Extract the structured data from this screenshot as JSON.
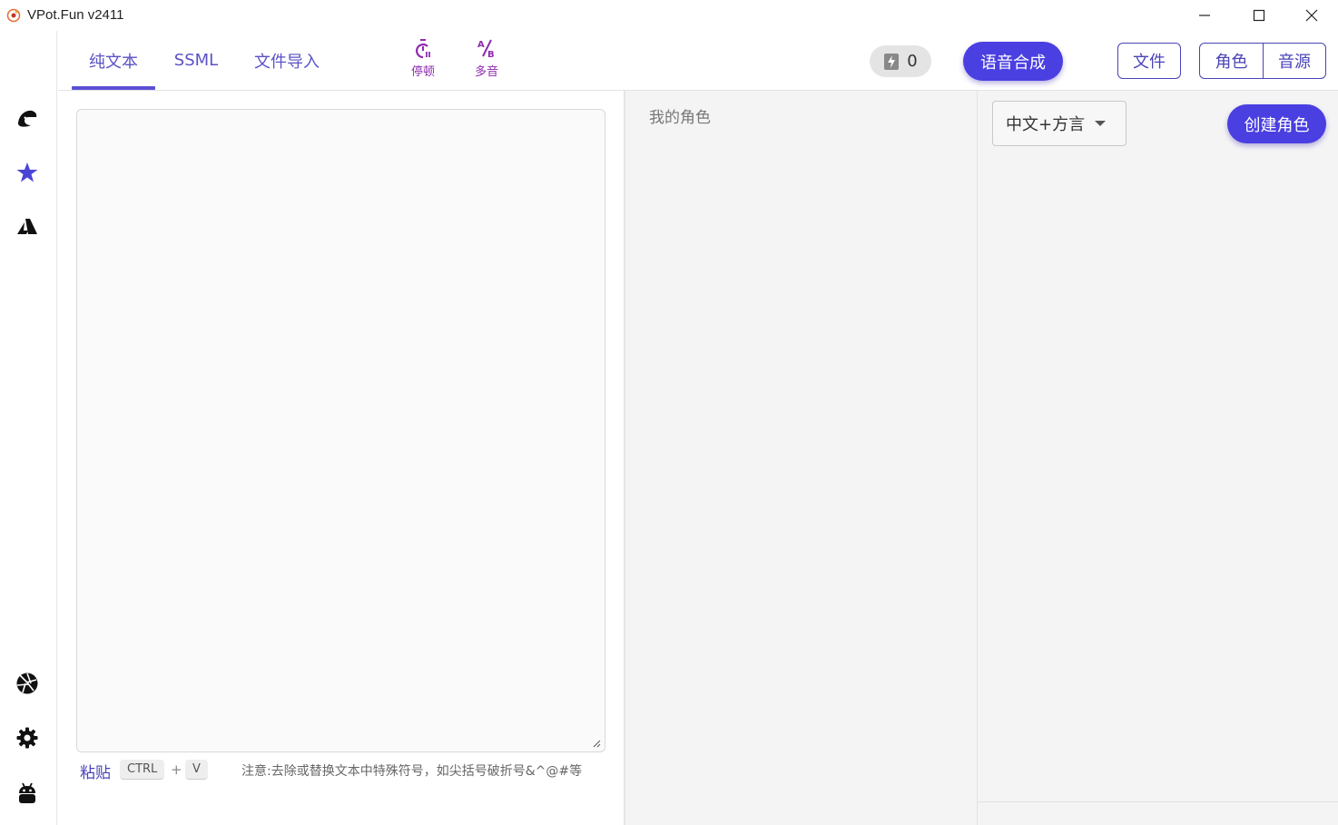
{
  "window": {
    "title": "VPot.Fun v2411"
  },
  "sidebar": {
    "icons": [
      "edge-icon",
      "star-icon",
      "azure-icon",
      "aperture-icon",
      "settings-icon",
      "android-icon"
    ]
  },
  "toolbar": {
    "tabs": [
      {
        "label": "纯文本",
        "active": true
      },
      {
        "label": "SSML",
        "active": false
      },
      {
        "label": "文件导入",
        "active": false
      }
    ],
    "tools": [
      {
        "label": "停顿",
        "icon": "timer-icon"
      },
      {
        "label": "多音",
        "icon": "ab-icon"
      }
    ],
    "counter_value": "0",
    "synthesize_label": "语音合成",
    "file_label": "文件",
    "role_label": "角色",
    "source_label": "音源"
  },
  "editor": {
    "text": "",
    "paste_label": "粘贴",
    "key_ctrl": "CTRL",
    "key_plus": "+",
    "key_v": "V",
    "note": "注意:去除或替换文本中特殊符号，如尖括号破折号&^@#等"
  },
  "roles": {
    "my_roles_label": "我的角色"
  },
  "right": {
    "language_select": "中文+方言",
    "create_role_label": "创建角色"
  },
  "colors": {
    "accent": "#4a3fe0",
    "tab_text": "#5b52c6",
    "tool_purple": "#8e2bb0"
  }
}
